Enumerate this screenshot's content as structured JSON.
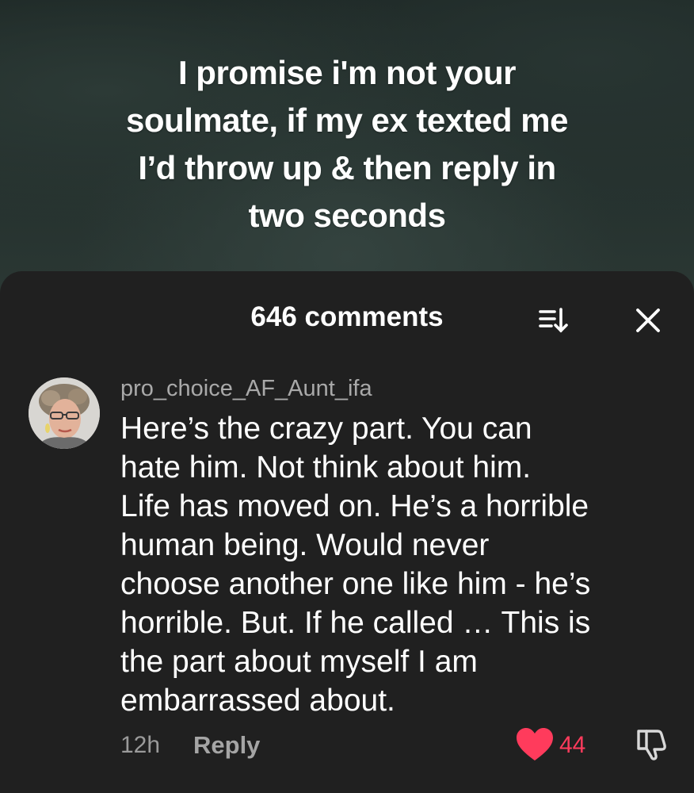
{
  "video": {
    "caption_lines": [
      "I promise i'm not your",
      "soulmate, if my ex texted me",
      "I’d throw up & then reply in",
      "two seconds"
    ]
  },
  "comments_panel": {
    "title": "646 comments",
    "sort_icon": "sort-list-icon",
    "close_icon": "close-icon"
  },
  "comment": {
    "username": "pro_choice_AF_Aunt_ifa",
    "text_lines": [
      "Here’s the crazy part. You can",
      "hate him. Not think about him.",
      "Life has moved on. He’s a horrible",
      "human being. Would never",
      "choose another one like him - he’s",
      "horrible. But. If he called … This is",
      "the part about myself I am",
      "embarrassed about."
    ],
    "timestamp": "12h",
    "reply_label": "Reply",
    "like_count": "44",
    "liked": true,
    "like_icon": "heart-icon",
    "dislike_icon": "thumbs-down-icon",
    "like_color": "#ff3b5c"
  }
}
